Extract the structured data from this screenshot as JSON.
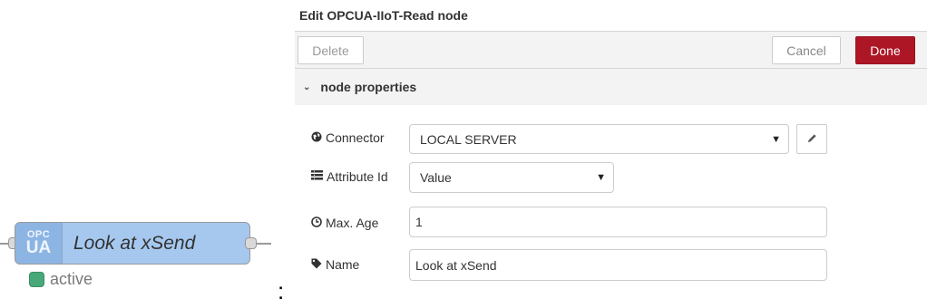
{
  "flow_node": {
    "icon_line1": "OPC",
    "icon_line2": "UA",
    "label": "Look at xSend",
    "status_text": "active",
    "status_color": "#48a878",
    "fill_color": "#a6c8ef"
  },
  "separator": ":",
  "tray": {
    "title": "Edit OPCUA-IIoT-Read node",
    "buttons": {
      "delete_label": "Delete",
      "cancel_label": "Cancel",
      "done_label": "Done",
      "done_color": "#ad1625"
    },
    "section": {
      "label": "node properties",
      "chevron_icon": "chevron-down-icon"
    },
    "fields": {
      "connector": {
        "icon": "globe-icon",
        "label": "Connector",
        "value": "LOCAL SERVER",
        "edit_icon": "pencil-icon"
      },
      "attribute_id": {
        "icon": "list-icon",
        "label": "Attribute Id",
        "value": "Value"
      },
      "max_age": {
        "icon": "clock-icon",
        "label": "Max. Age",
        "value": "1"
      },
      "name": {
        "icon": "tag-icon",
        "label": "Name",
        "value": "Look at xSend"
      }
    }
  }
}
